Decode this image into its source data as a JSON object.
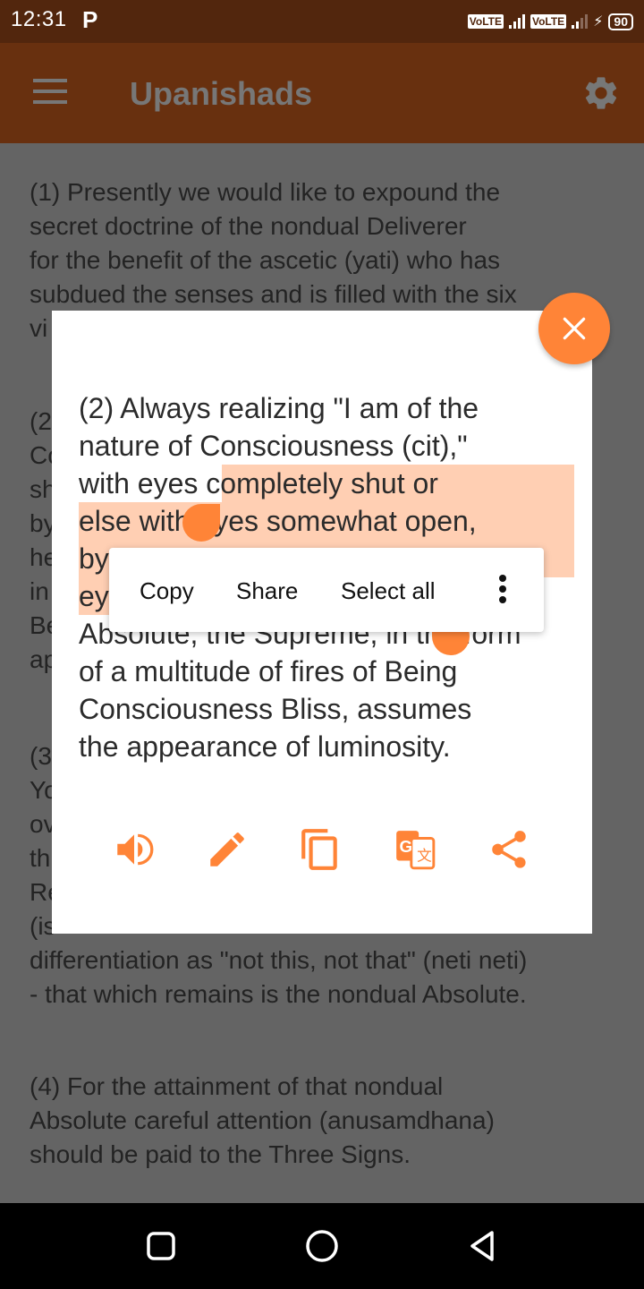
{
  "status_bar": {
    "time": "12:31",
    "notification_icon": "P",
    "sim1_label": "VoLTE",
    "sim2_label": "VoLTE",
    "battery_level": "90",
    "charging": true
  },
  "app_bar": {
    "title": "Upanishads",
    "menu_icon": "hamburger-menu-icon",
    "settings_icon": "gear-icon"
  },
  "background_content": {
    "paragraphs": [
      {
        "lines": [
          "(1) Presently we would like to expound the",
          "secret doctrine of the nondual Deliverer",
          "for the benefit of the ascetic (yati) who has",
          "subdued the senses and is filled with the six",
          "vi"
        ]
      },
      {
        "lines": [
          "(2",
          "Co",
          "sh",
          "by",
          "he",
          "in",
          "Be",
          "ap"
        ]
      },
      {
        "lines": [
          "(3",
          "Yo",
          "ov",
          "th",
          "Re",
          "(is",
          "differentiation as \"not this, not that\" (neti neti)",
          "- that which remains is the nondual Absolute."
        ]
      },
      {
        "lines": [
          "(4) For the attainment of that nondual",
          "Absolute careful attention (anusamdhana)",
          "should be paid to the Three Signs."
        ]
      }
    ]
  },
  "dialog": {
    "lines": [
      {
        "plain": "(2) Always realizing \"I am of the",
        "selected": ""
      },
      {
        "plain": "nature of Consciousness (cit),\"",
        "selected": ""
      },
      {
        "plain": "with eyes ",
        "selected": "completely shut or"
      },
      {
        "plain": "",
        "selected": "else with eyes somewhat open,"
      },
      {
        "plain": "",
        "selected": "by"
      },
      {
        "plain": "",
        "selected": "ey"
      },
      {
        "plain": "Absolute, the Supreme, in the form",
        "selected": ""
      },
      {
        "plain": "of a multitude of fires of Being",
        "selected": ""
      },
      {
        "plain": "Consciousness Bliss, assumes",
        "selected": ""
      },
      {
        "plain": "the appearance of luminosity.",
        "selected": ""
      }
    ],
    "close_icon": "close-icon",
    "context_menu": {
      "items": [
        "Copy",
        "Share",
        "Select all"
      ],
      "more_icon": "more-vert-icon"
    },
    "actions": [
      {
        "name": "speak",
        "icon": "volume-icon"
      },
      {
        "name": "edit",
        "icon": "pencil-icon"
      },
      {
        "name": "copy",
        "icon": "copy-icon"
      },
      {
        "name": "translate",
        "icon": "translate-icon"
      },
      {
        "name": "share",
        "icon": "share-icon"
      }
    ],
    "accent_color": "#ff8437",
    "selection_color": "#ffcfb3"
  },
  "nav_bar": {
    "recents_icon": "square-icon",
    "home_icon": "circle-icon",
    "back_icon": "triangle-back-icon"
  }
}
